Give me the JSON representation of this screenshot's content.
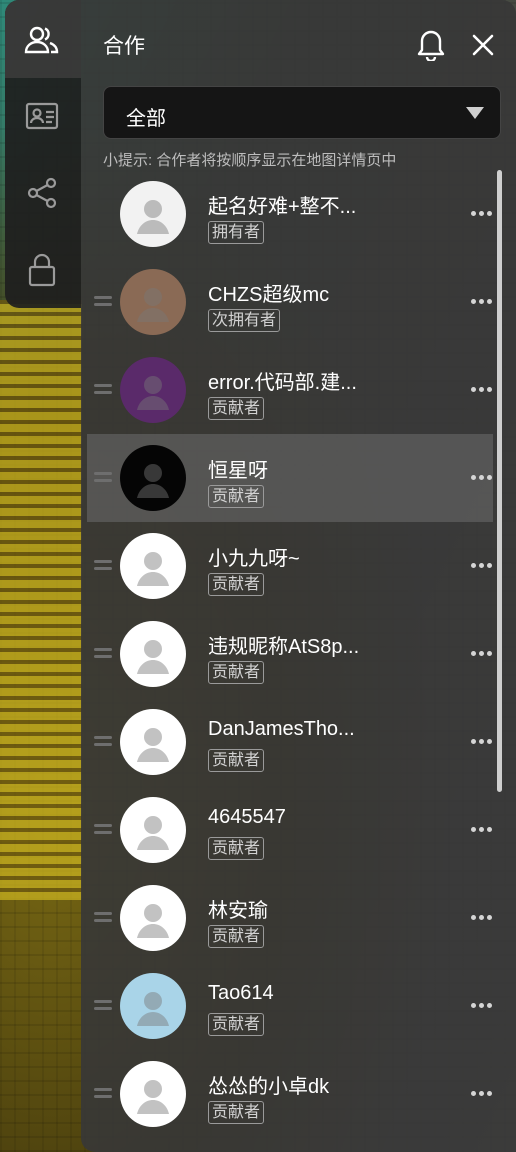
{
  "header": {
    "title": "合作",
    "bell_icon": "bell-icon",
    "close_icon": "close-icon"
  },
  "sidebar": {
    "items": [
      {
        "icon": "people-icon"
      },
      {
        "icon": "id-card-icon"
      },
      {
        "icon": "share-icon"
      },
      {
        "icon": "lock-icon"
      }
    ]
  },
  "filter": {
    "selected": "全部"
  },
  "hint": "小提示: 合作者将按顺序显示在地图详情页中",
  "collaborators": [
    {
      "name": "起名好难+整不...",
      "role": "拥有者",
      "avatar_color": "#f2f2f2"
    },
    {
      "name": "CHZS超级mc",
      "role": "次拥有者",
      "avatar_color": "#8a6a55"
    },
    {
      "name": "error.代码部.建...",
      "role": "贡献者",
      "avatar_color": "#5a2a6a"
    },
    {
      "name": "恒星呀",
      "role": "贡献者",
      "avatar_color": "#050505"
    },
    {
      "name": "小九九呀~",
      "role": "贡献者",
      "avatar_color": "#ffffff"
    },
    {
      "name": "违规昵称AtS8p...",
      "role": "贡献者",
      "avatar_color": "#ffffff"
    },
    {
      "name": "DanJamesTho...",
      "role": "贡献者",
      "avatar_color": "#ffffff"
    },
    {
      "name": "4645547",
      "role": "贡献者",
      "avatar_color": "#ffffff"
    },
    {
      "name": "林安瑜",
      "role": "贡献者",
      "avatar_color": "#ffffff"
    },
    {
      "name": "Tao614",
      "role": "贡献者",
      "avatar_color": "#a9d4e8"
    },
    {
      "name": "怂怂的小卓dk",
      "role": "贡献者",
      "avatar_color": "#ffffff"
    }
  ],
  "colors": {
    "panel": "#373737",
    "accent_text": "#ffffff",
    "row_highlight": "#6e6e6e"
  }
}
